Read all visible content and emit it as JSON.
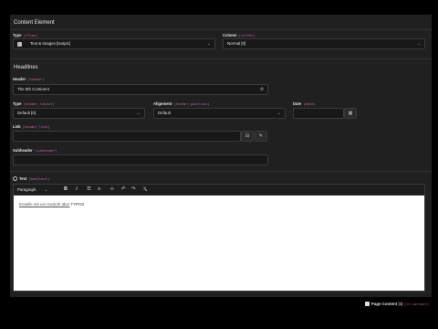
{
  "content_element": {
    "title": "Content Element",
    "type_label": "Type",
    "type_code": "[CType]",
    "type_value": "Text & Images [textpic]",
    "column_label": "Column",
    "column_code": "[colPos]",
    "column_value": "Normal [0]"
  },
  "headlines": {
    "title": "Headlines",
    "header_label": "Header",
    "header_code": "[header]",
    "header_value": "The 8th Continent",
    "type_label": "Type",
    "type_code": "[header_layout]",
    "type_value": "Default [0]",
    "alignment_label": "Alignment",
    "alignment_code": "[header_position]",
    "alignment_value": "Default",
    "date_label": "Date",
    "date_code": "[date]",
    "date_value": "",
    "link_label": "Link",
    "link_code": "[header_link]",
    "link_value": "",
    "subheader_label": "Subheader",
    "subheader_code": "[subheader]",
    "subheader_value": ""
  },
  "text": {
    "label": "Text",
    "code": "[bodytext]",
    "paragraph_select": "Paragraph",
    "bold": "B",
    "italic": "I",
    "body_underlined": "Erstelle mir ein Gedicht über",
    "body_rest": " TYPO3"
  },
  "footer": {
    "label": "Page Content",
    "count": "[3]",
    "code": "[tt_content]"
  },
  "colors": {
    "background": "#000000",
    "panel": "#202020",
    "field": "#181818",
    "code_accent": "#c0609f",
    "editor": "#ffffff"
  },
  "icons": {
    "type_icon": "content-type-icon",
    "calendar": "calendar-icon",
    "link_browse": "link-browse-icon",
    "link_pencil": "pencil-icon",
    "help": "help-icon"
  }
}
